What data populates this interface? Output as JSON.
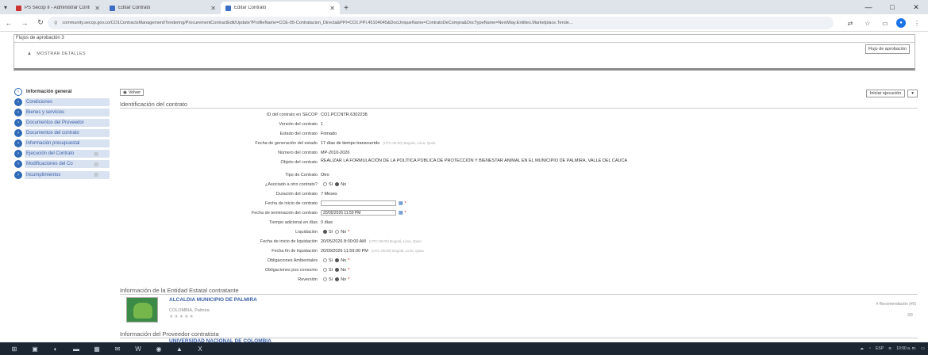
{
  "browser": {
    "tabs": [
      {
        "title": "PS Secop II - Administrar Contrato",
        "active": false
      },
      {
        "title": "Editar Contrato",
        "active": false
      },
      {
        "title": "Editar Contrato",
        "active": true
      }
    ],
    "new_tab": "+",
    "window_controls": {
      "minimize": "—",
      "maximize": "□",
      "close": "✕"
    },
    "url": "community.secop.gov.co/CO1ContractsManagement/Tendering/ProcurementContractEdit/Update?ProfileName=CCE-05-Contratacion_Directa&PPI=CO1.PPI.45104045&DocUniqueName=ContratoDeCompra&DocTypeName=NextWay.Entities.Marketplace.Tende..."
  },
  "approval": {
    "title": "Flujos de aprobación 3",
    "show_details": "MOSTRAR DETALLES",
    "button": "Flujo de aprobación"
  },
  "nav": [
    {
      "label": "Información general",
      "active": true,
      "locked": false
    },
    {
      "label": "Condiciones",
      "active": false,
      "locked": false
    },
    {
      "label": "Bienes y servicios",
      "active": false,
      "locked": false
    },
    {
      "label": "Documentos del Proveedor",
      "active": false,
      "locked": false
    },
    {
      "label": "Documentos del contrato",
      "active": false,
      "locked": false
    },
    {
      "label": "Información presupuestal",
      "active": false,
      "locked": false
    },
    {
      "label": "Ejecución del Contrato",
      "active": false,
      "locked": true
    },
    {
      "label": "Modificaciones del Co",
      "active": false,
      "locked": true
    },
    {
      "label": "Incumplimientos",
      "active": false,
      "locked": true
    }
  ],
  "main": {
    "back": "Volver",
    "start_execution": "Iniciar ejecución",
    "section_title": "Identificación del contrato",
    "fields": {
      "id_label": "ID del contrato en SECOP",
      "id_value": "CO1.PCCNTR.6302238",
      "version_label": "Versión del contrato",
      "version_value": "1",
      "status_label": "Estado del contrato",
      "status_value": "Firmado",
      "gen_date_label": "Fecha de generación del estado",
      "gen_date_value": "17 días de tiempo transcurrido",
      "gen_date_hint": "(UTC-05:00) Bogotá, Lima, Quito",
      "number_label": "Número del contrato",
      "number_value": "MP-2010-2026",
      "object_label": "Objeto del contrato",
      "object_value": "REALIZAR LA FORMULACIÓN DE LA POLÍTICA PÚBLICA DE PROTECCIÓN Y BIENESTAR ANIMAL EN EL MUNICIPIO DE PALMIRA, VALLE DEL CAUCA",
      "type_label": "Tipo de Contrato",
      "type_value": "Otro",
      "framework_label": "¿Asociado a otro contrato?",
      "yes": "Sí",
      "no": "No",
      "duration_label": "Duración del contrato",
      "duration_value": "7 Meses",
      "start_date_label": "Fecha de inicio de contrato",
      "start_date_value": "",
      "end_date_label": "Fecha de terminación del contrato",
      "end_date_value": "20/05/2026 11:59 PM",
      "extra_time_label": "Tiempo adicional en días",
      "extra_time_value": "0 días",
      "liquidation_label": "Liquidación",
      "liq_start_label": "Fecha de inicio de liquidación",
      "liq_start_value": "20/05/2026 8:00:00 AM",
      "liq_start_hint": "(UTC-05:00) Bogotá, Lima, Quito",
      "liq_end_label": "Fecha fin de liquidación",
      "liq_end_value": "20/09/2026 11:59:00 PM",
      "liq_end_hint": "(UTC-05:00) Bogotá, Lima, Quito",
      "env_label": "Obligaciones Ambientales",
      "post_label": "Obligaciones pos consumo",
      "reversion_label": "Reversión"
    },
    "entity_section": "Información de la Entidad Estatal contratante",
    "entity": {
      "name": "ALCALDIA MUNICIPIO DE PALMIRA",
      "location": "COLOMBIA, Palmira",
      "stars": "★★★★★",
      "right_note": "# Recomendación (#0)"
    },
    "provider_section": "Información del Proveedor contratista",
    "provider": {
      "name": "UNIVERSIDAD NACIONAL DE COLOMBIA"
    }
  },
  "taskbar": {
    "time": "10:00 a. m.",
    "lang": "ESP"
  }
}
